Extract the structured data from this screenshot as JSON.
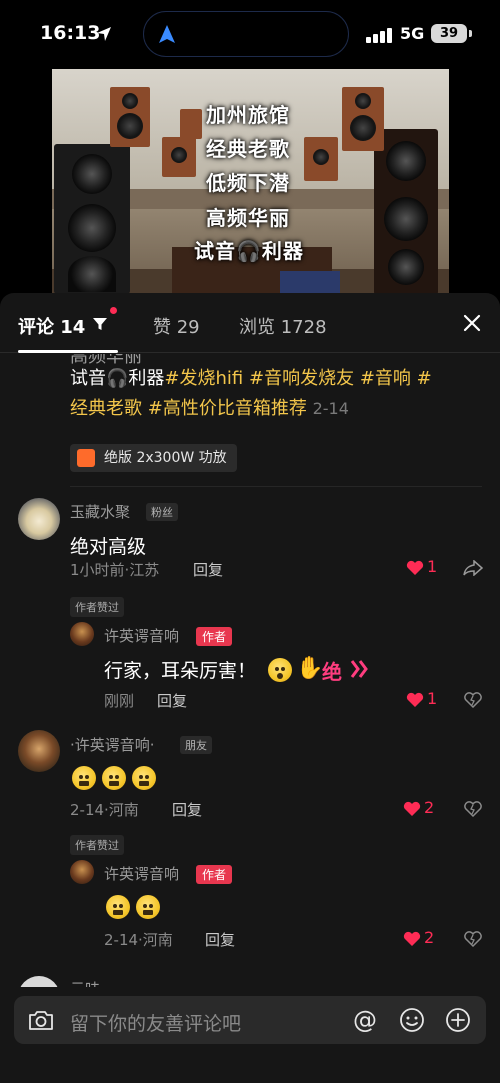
{
  "status_bar": {
    "time": "16:13",
    "network": "5G",
    "battery": "39"
  },
  "video": {
    "overlay_lines": [
      "加州旅馆",
      "经典老歌",
      "低频下潜",
      "高频华丽",
      "试音🎧利器"
    ]
  },
  "tabs": {
    "comments_label": "评论",
    "comments_count": "14",
    "likes_label": "赞",
    "likes_count": "29",
    "views_label": "浏览",
    "views_count": "1728"
  },
  "caption": {
    "cut_line": "高频华丽",
    "prefix": "试音🎧利器",
    "hashtags": [
      "#发烧hifi",
      "#音响发烧友",
      "#音响",
      "#经典老歌",
      "#高性价比音箱推荐"
    ],
    "date": "2-14",
    "shop_chip": "绝版 2x300W 功放"
  },
  "comments": [
    {
      "username": "玉藏水聚",
      "tag": "粉丝",
      "text": "绝对高级",
      "meta": "1小时前·江苏",
      "reply_label": "回复",
      "likes": "1",
      "liked_badge": "作者赞过",
      "reply": {
        "username": "许英谔音响",
        "author_tag": "作者",
        "text": "行家，耳朵厉害！",
        "extra_text": "绝",
        "meta": "刚刚",
        "reply_label": "回复",
        "likes": "1"
      }
    },
    {
      "username": "·许英谔音响·",
      "tag": "朋友",
      "meta": "2-14·河南",
      "reply_label": "回复",
      "likes": "2",
      "liked_badge": "作者赞过",
      "reply": {
        "username": "许英谔音响",
        "author_tag": "作者",
        "meta": "2-14·河南",
        "reply_label": "回复",
        "likes": "2"
      }
    },
    {
      "username": "云味"
    }
  ],
  "input": {
    "placeholder": "留下你的友善评论吧",
    "at_symbol": "@"
  },
  "colors": {
    "hashtag": "#f3c64b",
    "like_red": "#fe2c55",
    "author_tag_bg": "#e8374f",
    "sheet_bg": "#161616"
  }
}
